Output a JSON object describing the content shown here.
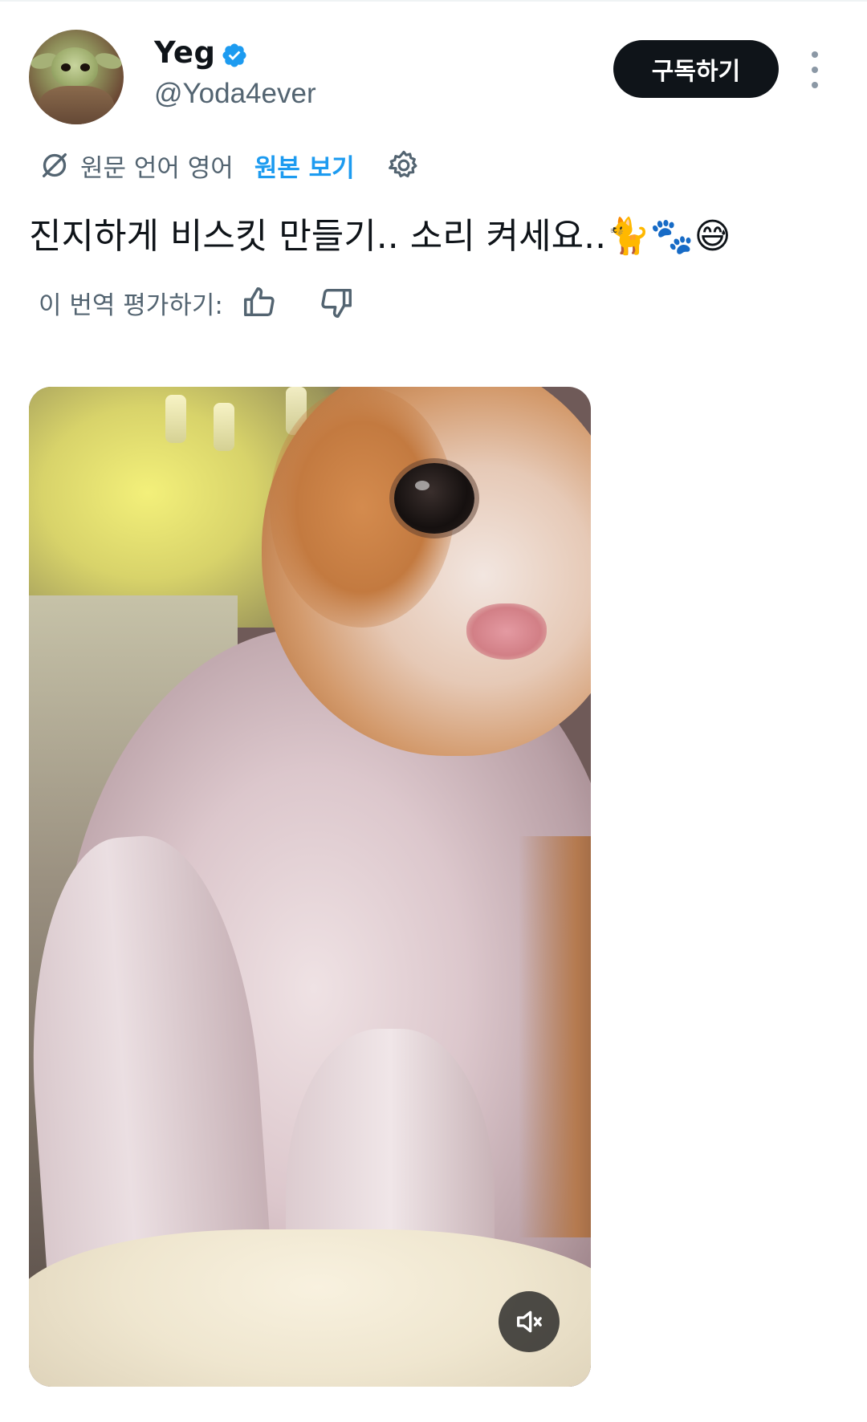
{
  "author": {
    "display_name": "Yeg",
    "handle": "@Yoda4ever",
    "verified": true,
    "avatar_icon": "baby-yoda-avatar"
  },
  "header": {
    "subscribe_label": "구독하기",
    "more_icon": "more-vertical-icon"
  },
  "translation": {
    "source_language": "원문 언어 영어",
    "show_original_label": "원본 보기",
    "settings_icon": "gear-icon"
  },
  "tweet": {
    "text": "진지하게 비스킷 만들기.. 소리 켜세요..🐈🐾😅"
  },
  "rating": {
    "prompt": "이 번역 평가하기:",
    "thumbs_up_icon": "thumbs-up-icon",
    "thumbs_down_icon": "thumbs-down-icon"
  },
  "media": {
    "type": "video",
    "muted": true,
    "mute_icon": "speaker-muted-icon"
  },
  "colors": {
    "accent": "#1d9bf0",
    "text_primary": "#0f1419",
    "text_secondary": "#536471",
    "button_bg": "#0f1419"
  }
}
